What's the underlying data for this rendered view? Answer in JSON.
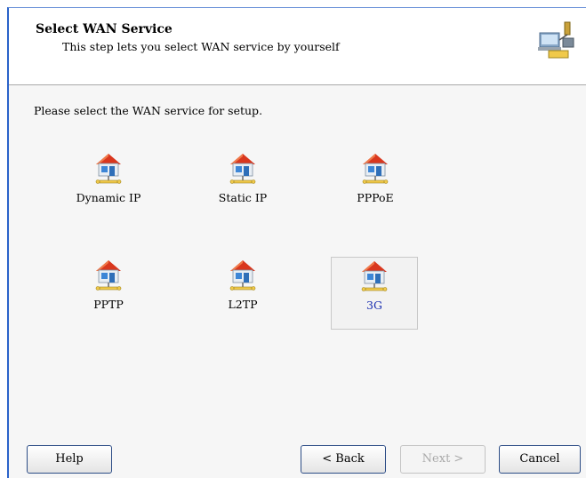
{
  "header": {
    "title": "Select WAN Service",
    "subtitle": "This step lets you select WAN service by yourself",
    "icon": "network-wizard-icon"
  },
  "prompt": "Please select the WAN service for setup.",
  "services": [
    {
      "label": "Dynamic IP",
      "icon": "house-network-icon",
      "selected": false
    },
    {
      "label": "Static IP",
      "icon": "house-network-icon",
      "selected": false
    },
    {
      "label": "PPPoE",
      "icon": "house-network-icon",
      "selected": false
    },
    {
      "label": "PPTP",
      "icon": "house-network-icon",
      "selected": false
    },
    {
      "label": "L2TP",
      "icon": "house-network-icon",
      "selected": false
    },
    {
      "label": "3G",
      "icon": "house-network-icon",
      "selected": true
    }
  ],
  "buttons": {
    "help": "Help",
    "back": "< Back",
    "next": "Next >",
    "cancel": "Cancel"
  },
  "colors": {
    "accent": "#2b63c9",
    "selected_label": "#1a2fb0"
  }
}
